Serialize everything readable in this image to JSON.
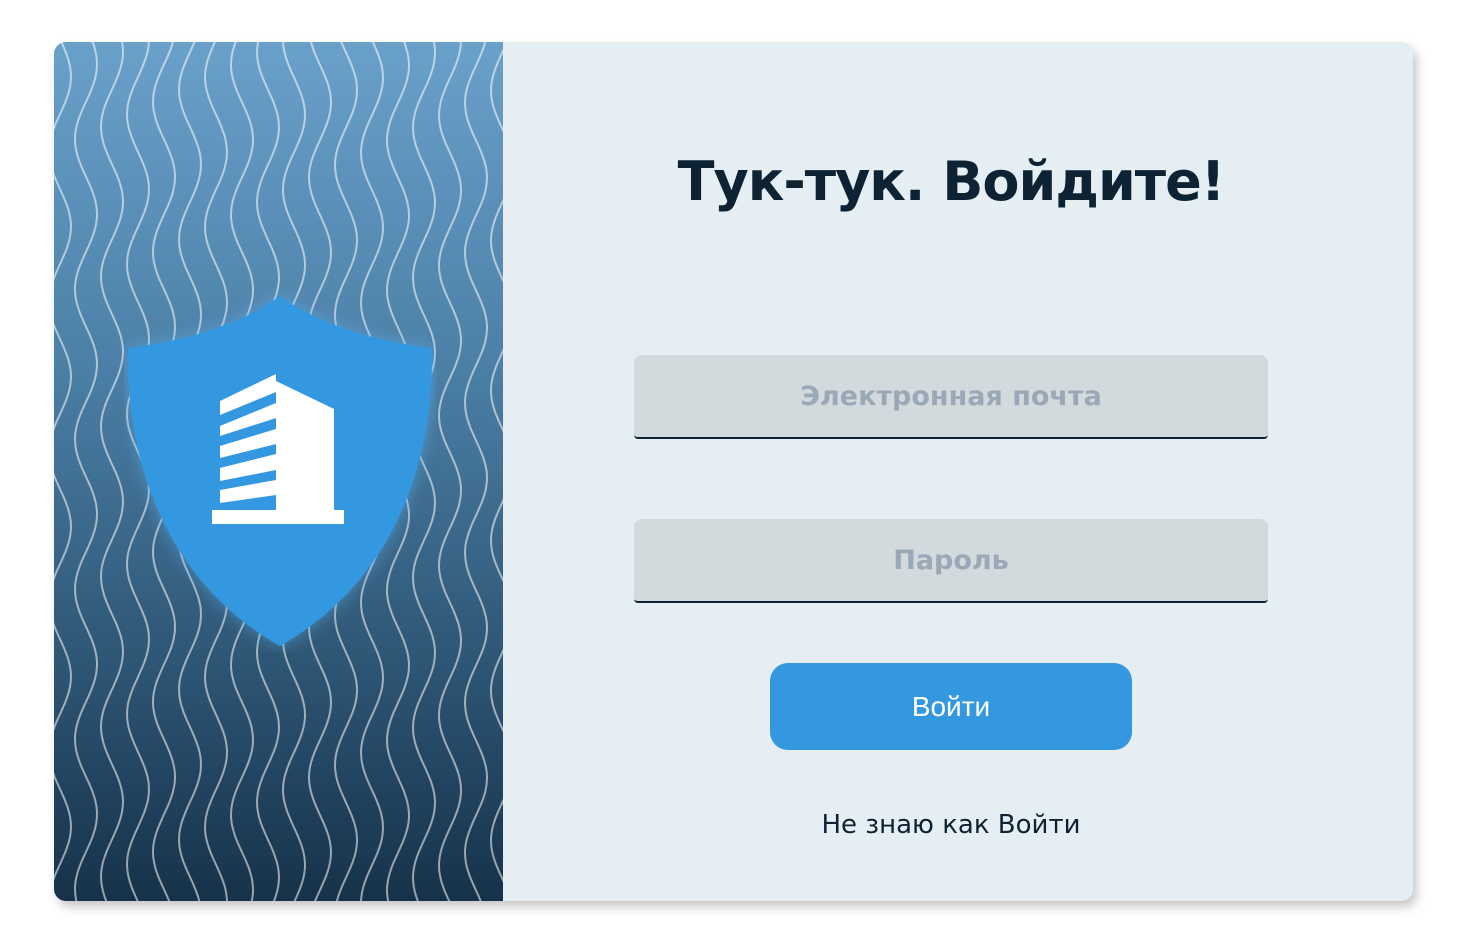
{
  "login": {
    "title": "Тук-тук. Войдите!",
    "email_placeholder": "Электронная почта",
    "email_value": "",
    "password_placeholder": "Пароль",
    "password_value": "",
    "submit_label": "Войти",
    "help_link": "Не знаю как Войти"
  },
  "icons": {
    "hero": "shield-building-icon"
  },
  "colors": {
    "accent": "#3498e0",
    "title_text": "#0d2233",
    "form_background": "#e5eef2",
    "field_background": "#d2dadd",
    "placeholder_text": "#9aa8b8",
    "panel_gradient_top": "#6aa1c9",
    "panel_gradient_bottom": "#16324a"
  }
}
